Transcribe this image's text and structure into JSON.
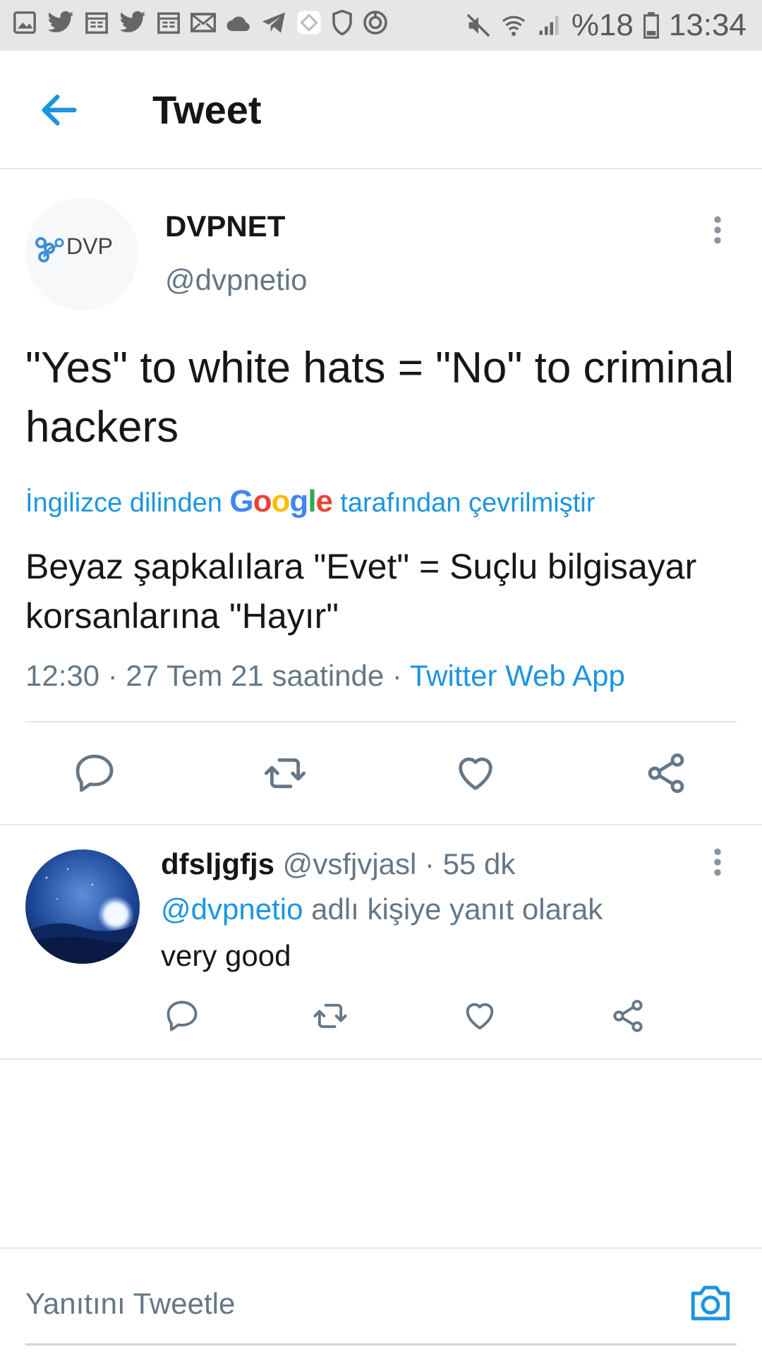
{
  "status_bar": {
    "battery": "%18",
    "time": "13:34",
    "icons": [
      "gallery-icon",
      "twitter-icon",
      "calendar-icon",
      "twitter-icon",
      "calendar-icon",
      "mail-icon",
      "cloud-icon",
      "telegram-icon",
      "app-icon",
      "shield-icon",
      "power-icon",
      "mute-icon",
      "wifi-icon",
      "signal-icon",
      "battery-icon"
    ]
  },
  "header": {
    "title": "Tweet",
    "back_icon": "arrow-left-icon"
  },
  "tweet": {
    "author_name": "DVPNET",
    "author_handle": "@dvpnetio",
    "avatar_text": "DVP",
    "text": "\"Yes\" to white hats = \"No\" to criminal hackers",
    "translated_prefix": "İngilizce dilinden",
    "translated_brand": "Google",
    "translated_suffix": "tarafından çevrilmiştir",
    "translation": "Beyaz şapkalılara \"Evet\" = Suçlu bilgisayar korsanlarına \"Hayır\"",
    "timestamp": "12:30 · 27 Tem 21 saatinde · ",
    "source": "Twitter Web App"
  },
  "reply": {
    "name": "dfsljgfjs",
    "handle_time": " @vsfjvjasl · 55 dk",
    "mention": "@dvpnetio",
    "reply_to_suffix": " adlı kişiye yanıt olarak",
    "text": "very good"
  },
  "compose": {
    "placeholder": "Yanıtını Tweetle"
  },
  "colors": {
    "accent": "#1b95e0",
    "text": "#14171a",
    "secondary": "#657786",
    "divider": "#e1e8ed"
  }
}
